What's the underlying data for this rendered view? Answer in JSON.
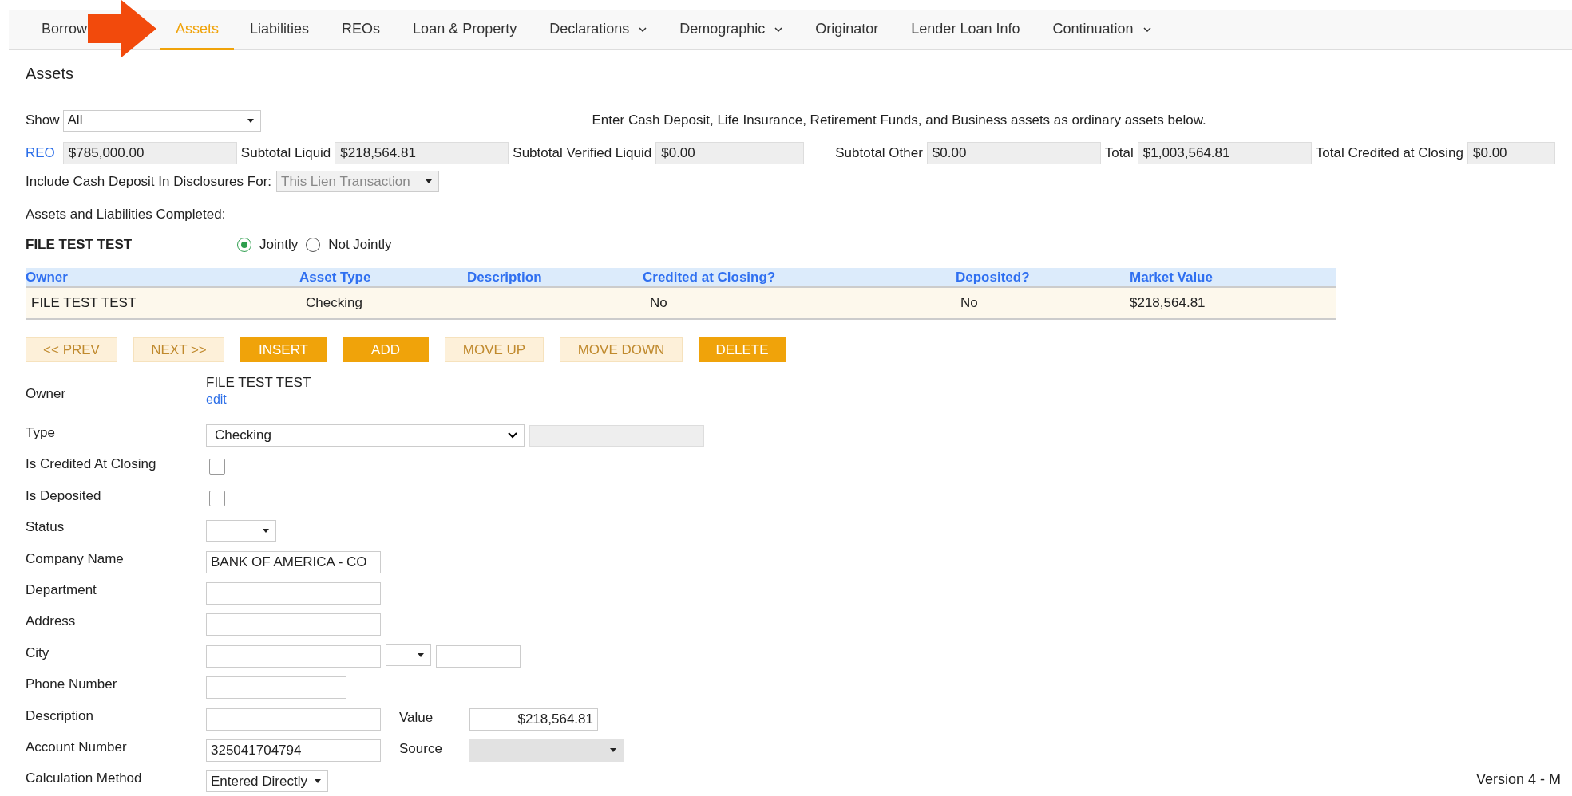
{
  "tabs": [
    {
      "label": "Borrow",
      "selected": false,
      "has_menu": false
    },
    {
      "label": "Assets",
      "selected": true,
      "has_menu": false
    },
    {
      "label": "Liabilities",
      "selected": false,
      "has_menu": false
    },
    {
      "label": "REOs",
      "selected": false,
      "has_menu": false
    },
    {
      "label": "Loan & Property",
      "selected": false,
      "has_menu": false
    },
    {
      "label": "Declarations",
      "selected": false,
      "has_menu": true
    },
    {
      "label": "Demographic",
      "selected": false,
      "has_menu": true
    },
    {
      "label": "Originator",
      "selected": false,
      "has_menu": false
    },
    {
      "label": "Lender Loan Info",
      "selected": false,
      "has_menu": false
    },
    {
      "label": "Continuation",
      "selected": false,
      "has_menu": true
    }
  ],
  "page_title": "Assets",
  "show": {
    "label": "Show",
    "value": "All"
  },
  "notice": "Enter Cash Deposit, Life Insurance, Retirement Funds, and Business assets as ordinary assets below.",
  "totals": [
    {
      "label": "REO",
      "value": "$785,000.00",
      "kind": "link"
    },
    {
      "label": "Subtotal Liquid",
      "value": "$218,564.81",
      "kind": "text"
    },
    {
      "label": "Subtotal Verified Liquid",
      "value": "$0.00",
      "kind": "text"
    },
    {
      "label": "Subtotal Other",
      "value": "$0.00",
      "kind": "text"
    },
    {
      "label": "Total",
      "value": "$1,003,564.81",
      "kind": "text"
    },
    {
      "label": "Total Credited at Closing",
      "value": "$0.00",
      "kind": "text"
    }
  ],
  "include_cash": {
    "label": "Include Cash Deposit In Disclosures For:",
    "value": "This Lien Transaction",
    "disabled": true
  },
  "completed_label": "Assets and Liabilities Completed:",
  "borrower": {
    "name": "FILE TEST TEST",
    "options": [
      {
        "label": "Jointly",
        "selected": true
      },
      {
        "label": "Not Jointly",
        "selected": false
      }
    ]
  },
  "table": {
    "columns": [
      "Owner",
      "Asset Type",
      "Description",
      "Credited at Closing?",
      "Deposited?",
      "Market Value"
    ],
    "rows": [
      {
        "cells": [
          "FILE TEST TEST",
          "Checking",
          "",
          "No",
          "No",
          "$218,564.81"
        ],
        "selected": true
      }
    ]
  },
  "buttons": [
    {
      "label": "<< PREV",
      "disabled": true
    },
    {
      "label": "NEXT >>",
      "disabled": true
    },
    {
      "label": "INSERT",
      "disabled": false
    },
    {
      "label": "ADD",
      "disabled": false
    },
    {
      "label": "MOVE UP",
      "disabled": true
    },
    {
      "label": "MOVE DOWN",
      "disabled": true
    },
    {
      "label": "DELETE",
      "disabled": false
    }
  ],
  "form": [
    {
      "kind": "owner",
      "label": "Owner",
      "value": "FILE TEST TEST",
      "link": "edit"
    },
    {
      "kind": "type",
      "label": "Type",
      "value": "Checking"
    },
    {
      "kind": "checkbox",
      "label": "Is Credited At Closing",
      "checked": false
    },
    {
      "kind": "checkbox",
      "label": "Is Deposited",
      "checked": false
    },
    {
      "kind": "small_select",
      "label": "Status"
    },
    {
      "kind": "input",
      "label": "Company Name",
      "value": "BANK OF AMERICA - CO"
    },
    {
      "kind": "input",
      "label": "Department"
    },
    {
      "kind": "input",
      "label": "Address"
    },
    {
      "kind": "city",
      "label": "City"
    },
    {
      "kind": "short_input",
      "label": "Phone Number"
    },
    {
      "kind": "input",
      "label": "Description",
      "side": {
        "kind": "amount",
        "label": "Value",
        "value": "$218,564.81"
      }
    },
    {
      "kind": "input",
      "label": "Account Number",
      "value": "325041704794",
      "side": {
        "kind": "grey_select",
        "label": "Source"
      }
    },
    {
      "kind": "method",
      "label": "Calculation Method",
      "value": "Entered Directly"
    }
  ],
  "version": "Version 4 - M"
}
